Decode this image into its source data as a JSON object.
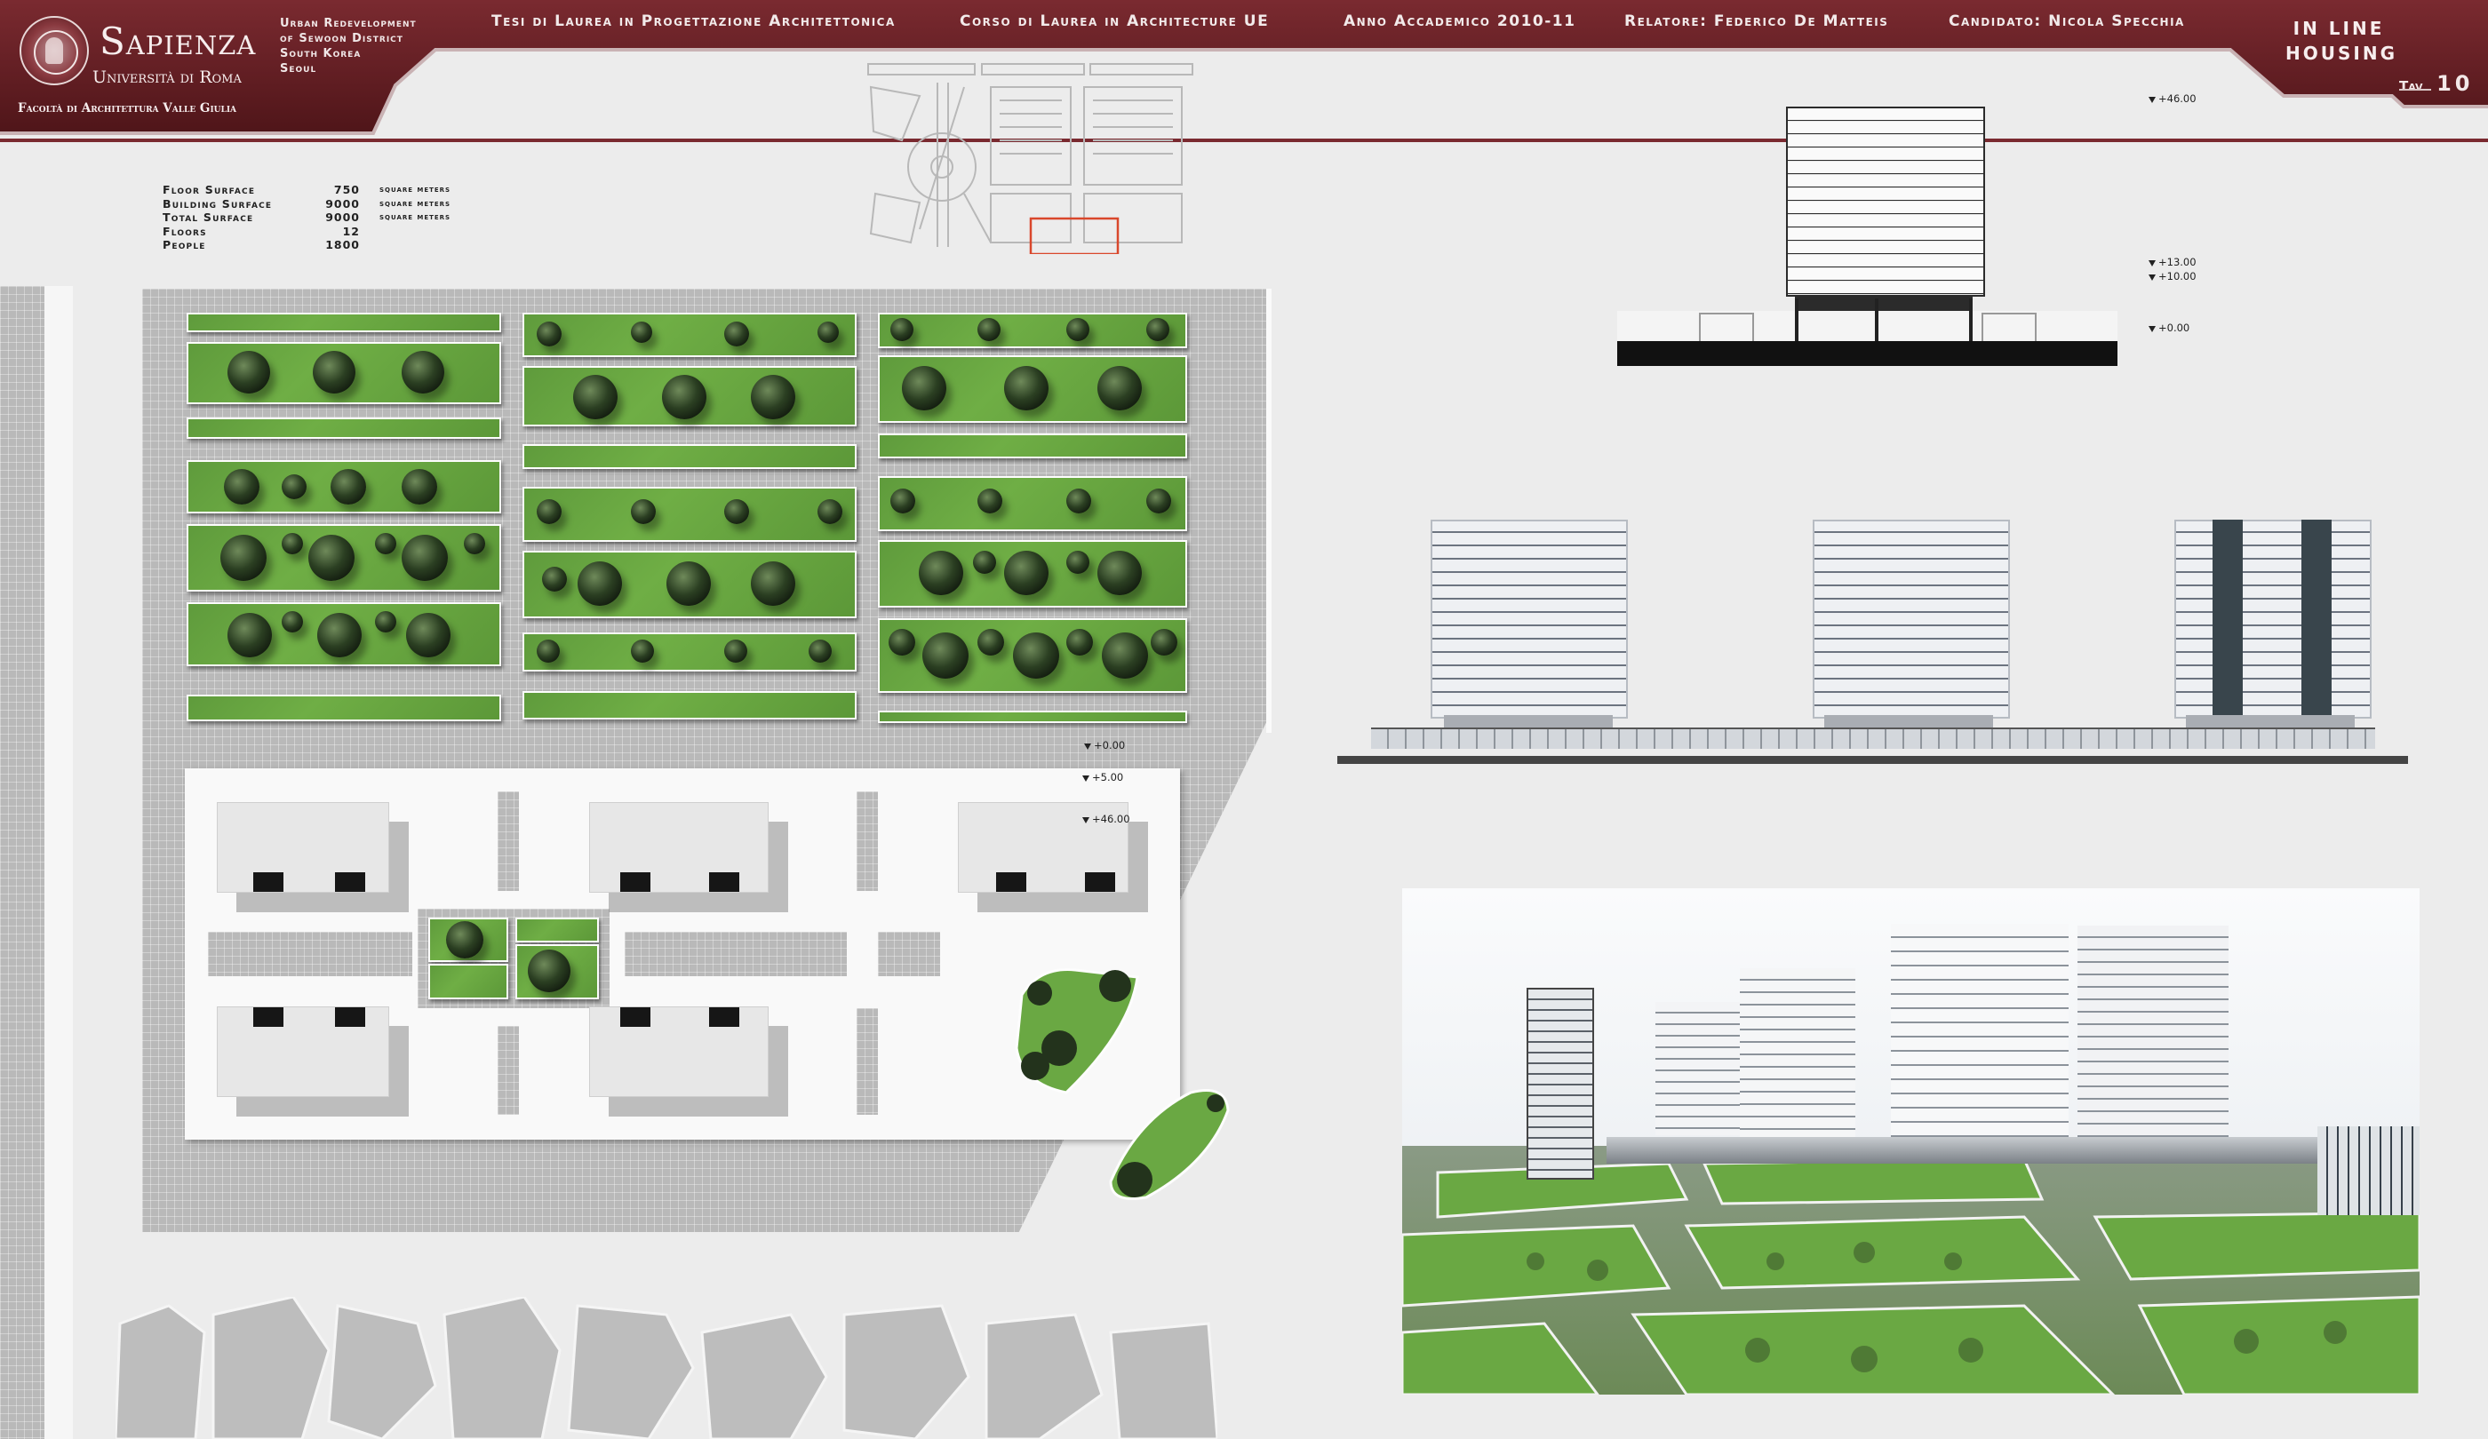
{
  "header": {
    "university_name": "Sapienza",
    "university_sub": "Università di Roma",
    "faculty": "Facoltà di Architettura Valle Giulia",
    "project_lines": [
      "Urban Redevelopment",
      "of Sewoon District",
      "South Korea",
      "Seoul"
    ],
    "thesis": "Tesi di Laurea in Progettazione Architettonica",
    "course": "Corso di Laurea in Architecture UE",
    "year": "Anno Accademico 2010-11",
    "supervisor": "Relatore: Federico De Matteis",
    "candidate": "Candidato: Nicola Specchia",
    "sheet_title_1": "IN LINE",
    "sheet_title_2": "HOUSING",
    "tav_label": "Tav",
    "tav_number": "10"
  },
  "stats": [
    {
      "label": "Floor Surface",
      "value": "750",
      "unit": "square meters"
    },
    {
      "label": "Building Surface",
      "value": "9000",
      "unit": "square meters"
    },
    {
      "label": "Total Surface",
      "value": "9000",
      "unit": "square meters"
    },
    {
      "label": "Floors",
      "value": "12",
      "unit": ""
    },
    {
      "label": "People",
      "value": "1800",
      "unit": ""
    }
  ],
  "section_levels": [
    "+46.00",
    "+13.00",
    "+10.00",
    "+0.00"
  ],
  "plan_levels": [
    "+0.00",
    "+5.00",
    "+46.00"
  ],
  "colors": {
    "header_bg": "#6e2228",
    "accent": "#8a2a30",
    "grass": "#6aa843",
    "highlight": "#d9472b"
  }
}
